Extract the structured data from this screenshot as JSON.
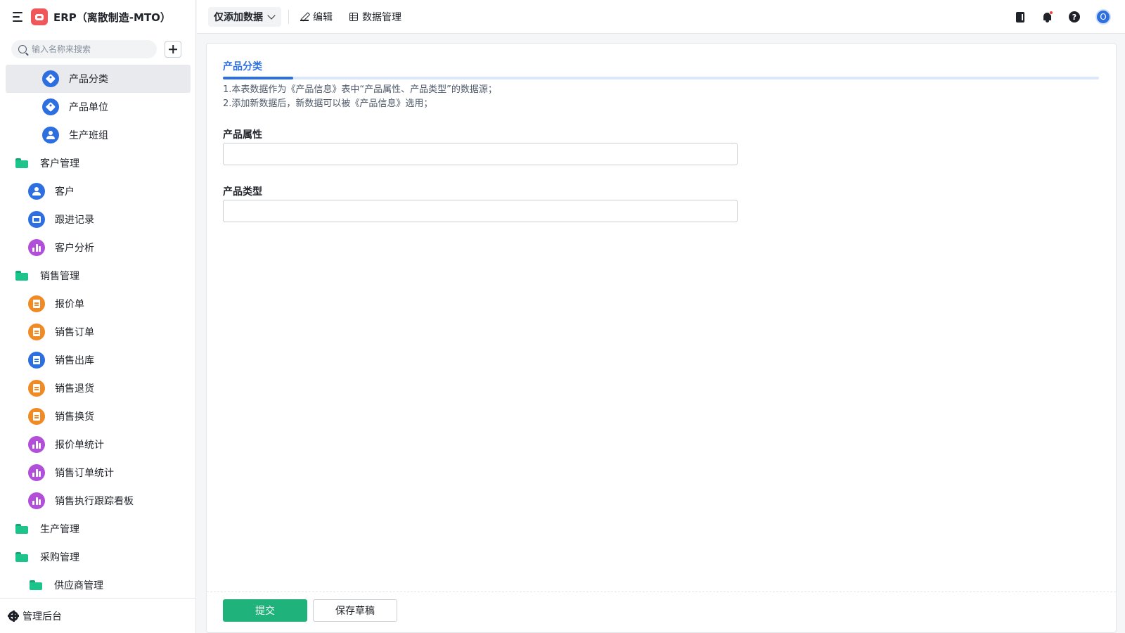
{
  "app": {
    "title": "ERP（离散制造-MTO）"
  },
  "search": {
    "placeholder": "输入名称来搜索"
  },
  "sidebar": {
    "items": [
      {
        "label": "产品分类",
        "icon": "tag-icon",
        "type": "form",
        "active": true
      },
      {
        "label": "产品单位",
        "icon": "tag-icon",
        "type": "form"
      },
      {
        "label": "生产班组",
        "icon": "person-icon",
        "type": "form"
      },
      {
        "label": "客户管理",
        "icon": "folder-icon",
        "type": "folder"
      },
      {
        "label": "客户",
        "icon": "person-icon",
        "type": "form"
      },
      {
        "label": "跟进记录",
        "icon": "inbox-icon",
        "type": "form"
      },
      {
        "label": "客户分析",
        "icon": "bar-chart-icon",
        "type": "report"
      },
      {
        "label": "销售管理",
        "icon": "folder-icon",
        "type": "folder"
      },
      {
        "label": "报价单",
        "icon": "document-icon",
        "type": "form"
      },
      {
        "label": "销售订单",
        "icon": "document-icon",
        "type": "form"
      },
      {
        "label": "销售出库",
        "icon": "document-icon",
        "type": "form"
      },
      {
        "label": "销售退货",
        "icon": "document-icon",
        "type": "form"
      },
      {
        "label": "销售换货",
        "icon": "document-icon",
        "type": "form"
      },
      {
        "label": "报价单统计",
        "icon": "bar-chart-icon",
        "type": "report"
      },
      {
        "label": "销售订单统计",
        "icon": "bar-chart-icon",
        "type": "report"
      },
      {
        "label": "销售执行跟踪看板",
        "icon": "bar-chart-icon",
        "type": "report"
      },
      {
        "label": "生产管理",
        "icon": "folder-icon",
        "type": "folder"
      },
      {
        "label": "采购管理",
        "icon": "folder-icon",
        "type": "folder"
      },
      {
        "label": "供应商管理",
        "icon": "folder-icon",
        "type": "subfolder"
      }
    ],
    "footer_label": "管理后台"
  },
  "topbar": {
    "view_select": "仅添加数据",
    "edit_label": "编辑",
    "data_manage_label": "数据管理",
    "avatar_initial": "O"
  },
  "form": {
    "section_title": "产品分类",
    "progress": 0.08,
    "description": [
      "1.本表数据作为《产品信息》表中“产品属性、产品类型”的数据源；",
      "2.添加新数据后，新数据可以被《产品信息》选用；"
    ],
    "fields": [
      {
        "label": "产品属性",
        "value": ""
      },
      {
        "label": "产品类型",
        "value": ""
      }
    ],
    "submit_label": "提交",
    "draft_label": "保存草稿"
  },
  "colors": {
    "accent": "#2e6fe0",
    "submit": "#1fb27a",
    "folder": "#1cc38a",
    "orange_icon": "#f08a24",
    "purple_icon": "#b24fd9"
  }
}
